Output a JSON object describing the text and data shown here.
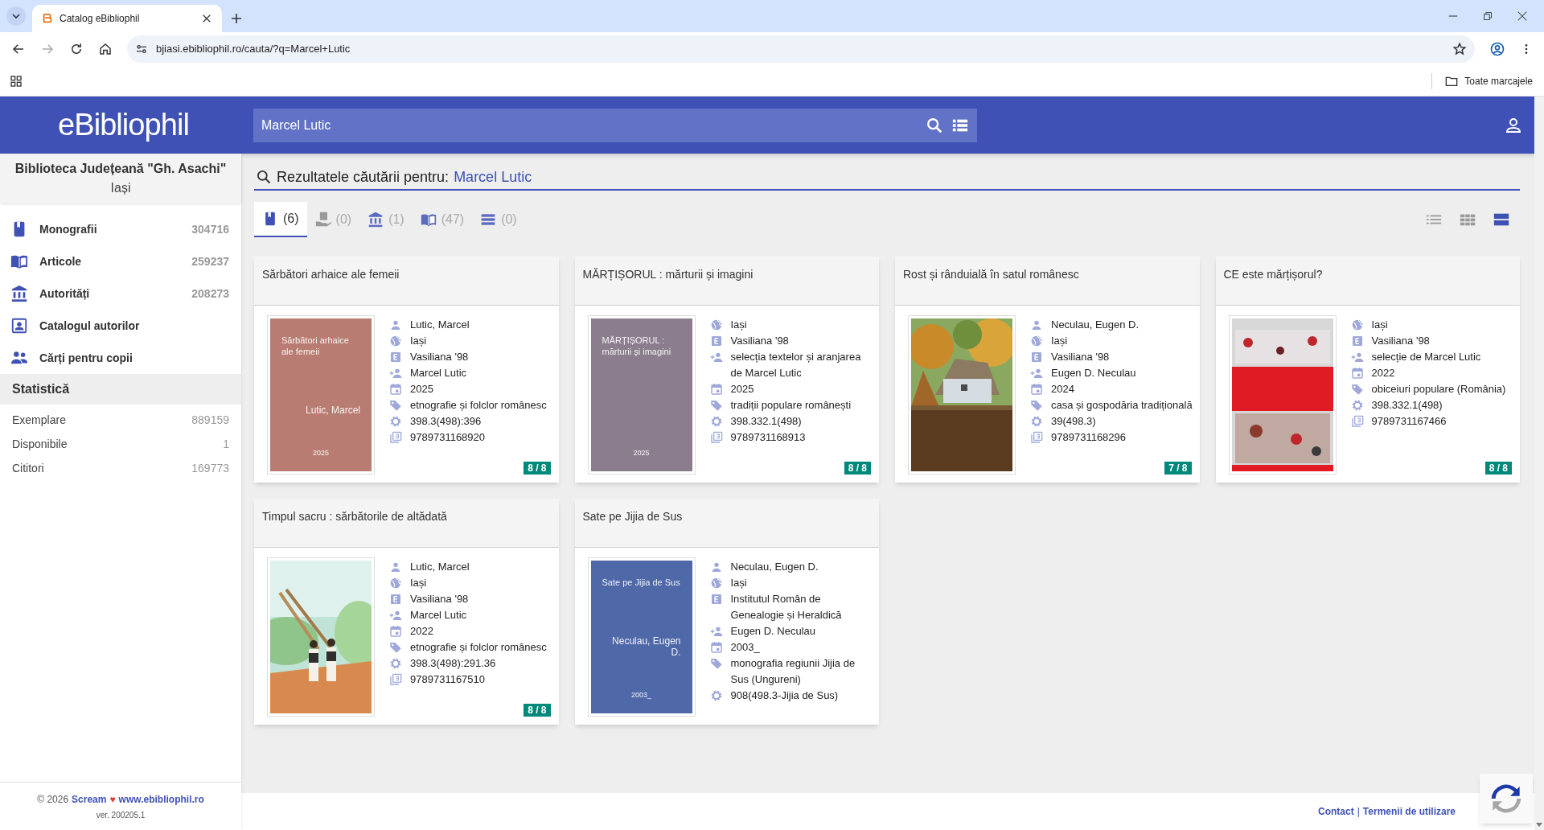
{
  "browser": {
    "tab_title": "Catalog eBibliophil",
    "url": "bjiasi.ebibliophil.ro/cauta/?q=Marcel+Lutic",
    "bookmarks_label": "Toate marcajele"
  },
  "header": {
    "logo": "eBibliophil",
    "search_value": "Marcel Lutic"
  },
  "sidebar": {
    "library_name": "Biblioteca Județeană \"Gh. Asachi\"",
    "city": "Iași",
    "items": [
      {
        "kind": "book",
        "label": "Monografii",
        "count": "304716"
      },
      {
        "kind": "open-book",
        "label": "Articole",
        "count": "259237"
      },
      {
        "kind": "institution",
        "label": "Autorități",
        "count": "208273"
      },
      {
        "kind": "contact",
        "label": "Catalogul autorilor"
      },
      {
        "kind": "people",
        "label": "Cărți pentru copii"
      }
    ],
    "stats_title": "Statistică",
    "stats": [
      {
        "label": "Exemplare",
        "value": "889159"
      },
      {
        "label": "Disponibile",
        "value": "1"
      },
      {
        "label": "Cititori",
        "value": "169773"
      }
    ],
    "footer": {
      "copyright": "© 2026",
      "brand": "Scream",
      "heart": "♥",
      "site": "www.ebibliophil.ro",
      "version": "ver. 200205.1"
    }
  },
  "results": {
    "heading_label": "Rezultatele căutării pentru:",
    "query": "Marcel Lutic",
    "tabs": [
      {
        "kind": "book",
        "count": "(6)",
        "selected": true
      },
      {
        "kind": "hand-book",
        "count": "(0)",
        "selected": false
      },
      {
        "kind": "institution",
        "count": "(1)",
        "selected": false
      },
      {
        "kind": "open-book",
        "count": "(47)",
        "selected": false
      },
      {
        "kind": "list",
        "count": "(0)",
        "selected": false
      }
    ],
    "views": [
      {
        "kind": "list",
        "selected": false
      },
      {
        "kind": "grid",
        "selected": false
      },
      {
        "kind": "cards",
        "selected": true
      }
    ],
    "cards": [
      {
        "title": "Sărbători arhaice ale femeii",
        "cover": {
          "kind": "placeholder",
          "color": "#b97c72",
          "title": "Sărbători arhaice ale femeii",
          "author": "Lutic, Marcel",
          "year": "2025"
        },
        "fields": [
          {
            "kind": "author",
            "text": "Lutic, Marcel"
          },
          {
            "kind": "place",
            "text": "Iași"
          },
          {
            "kind": "publisher",
            "text": "Vasiliana '98"
          },
          {
            "kind": "contributor",
            "text": "Marcel Lutic"
          },
          {
            "kind": "year",
            "text": "2025"
          },
          {
            "kind": "subject",
            "text": "etnografie și folclor românesc"
          },
          {
            "kind": "classification",
            "text": "398.3(498):396"
          },
          {
            "kind": "isbn",
            "text": "9789731168920"
          }
        ],
        "availability": "8 / 8"
      },
      {
        "title": "MĂRȚIȘORUL : mărturii și imagini",
        "cover": {
          "kind": "placeholder",
          "color": "#8c7d8e",
          "title": "MĂRȚIȘORUL : mărturii și imagini",
          "year": "2025"
        },
        "fields": [
          {
            "kind": "place",
            "text": "Iași"
          },
          {
            "kind": "publisher",
            "text": "Vasiliana '98"
          },
          {
            "kind": "contributor",
            "text": "selecția textelor și aranjarea de Marcel Lutic"
          },
          {
            "kind": "year",
            "text": "2025"
          },
          {
            "kind": "subject",
            "text": "tradiții populare românești"
          },
          {
            "kind": "classification",
            "text": "398.332.1(498)"
          },
          {
            "kind": "isbn",
            "text": "9789731168913"
          }
        ],
        "availability": "8 / 8"
      },
      {
        "title": "Rost și rânduială în satul românesc",
        "cover": {
          "kind": "picture"
        },
        "fields": [
          {
            "kind": "author",
            "text": "Neculau, Eugen D."
          },
          {
            "kind": "place",
            "text": "Iași"
          },
          {
            "kind": "publisher",
            "text": "Vasiliana '98"
          },
          {
            "kind": "contributor",
            "text": "Eugen D. Neculau"
          },
          {
            "kind": "year",
            "text": "2024"
          },
          {
            "kind": "subject",
            "text": "casa și gospodăria tradițională"
          },
          {
            "kind": "classification",
            "text": "39(498.3)"
          },
          {
            "kind": "isbn",
            "text": "9789731168296"
          }
        ],
        "availability": "7 / 8"
      },
      {
        "title": "CE este mărțișorul?",
        "cover": {
          "kind": "picture"
        },
        "fields": [
          {
            "kind": "place",
            "text": "Iași"
          },
          {
            "kind": "publisher",
            "text": "Vasiliana '98"
          },
          {
            "kind": "contributor",
            "text": "selecție de Marcel Lutic"
          },
          {
            "kind": "year",
            "text": "2022"
          },
          {
            "kind": "subject",
            "text": "obiceiuri populare (România)"
          },
          {
            "kind": "classification",
            "text": "398.332.1(498)"
          },
          {
            "kind": "isbn",
            "text": "9789731167466"
          }
        ],
        "availability": "8 / 8"
      },
      {
        "title": "Timpul sacru : sărbătorile de altădată",
        "cover": {
          "kind": "picture"
        },
        "fields": [
          {
            "kind": "author",
            "text": "Lutic, Marcel"
          },
          {
            "kind": "place",
            "text": "Iași"
          },
          {
            "kind": "publisher",
            "text": "Vasiliana '98"
          },
          {
            "kind": "contributor",
            "text": "Marcel Lutic"
          },
          {
            "kind": "year",
            "text": "2022"
          },
          {
            "kind": "subject",
            "text": "etnografie și folclor românesc"
          },
          {
            "kind": "classification",
            "text": "398.3(498):291.36"
          },
          {
            "kind": "isbn",
            "text": "9789731167510"
          }
        ],
        "availability": "8 / 8"
      },
      {
        "title": "Sate pe Jijia de Sus",
        "cover": {
          "kind": "placeholder",
          "color": "#4f68a8",
          "title": "Sate pe Jijia de Sus",
          "author": "Neculau, Eugen D.",
          "year": "2003_"
        },
        "fields": [
          {
            "kind": "author",
            "text": "Neculau, Eugen D."
          },
          {
            "kind": "place",
            "text": "Iași"
          },
          {
            "kind": "publisher",
            "text": "Institutul Român de Genealogie și Heraldică"
          },
          {
            "kind": "contributor",
            "text": "Eugen D. Neculau"
          },
          {
            "kind": "year",
            "text": "2003_"
          },
          {
            "kind": "subject",
            "text": "monografia regiunii Jijia de Sus (Ungureni)"
          },
          {
            "kind": "classification",
            "text": "908(498.3-Jijia de Sus)"
          }
        ]
      }
    ]
  },
  "footer": {
    "links": [
      "Contact",
      "Termenii de utilizare"
    ],
    "separator": "|"
  }
}
